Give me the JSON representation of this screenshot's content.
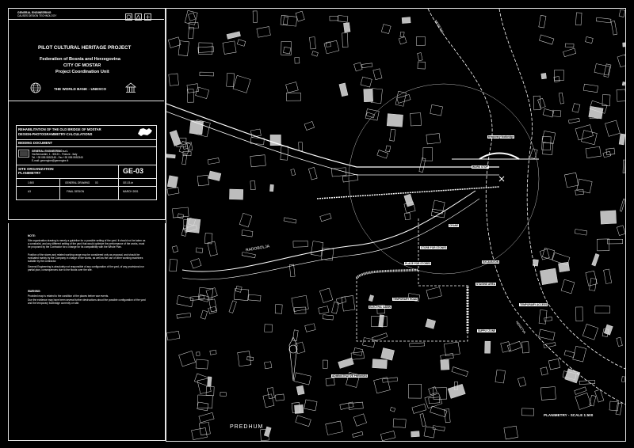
{
  "company": {
    "name": "GENERAL ENGINEERING",
    "sub": "CAUSES DESIGN TECHNOLOGY"
  },
  "project": {
    "title": "PILOT CULTURAL HERITAGE PROJECT",
    "line1": "Federation of Bosnia and Herzegovina",
    "line2": "CITY OF MOSTAR",
    "line3": "Project Coordination Unit",
    "sponsor": "THE WORLD BANK - UNESCO"
  },
  "titleblock": {
    "rehab1": "REHABILITATION OF THE OLD BRIDGE OF MOSTAR",
    "rehab2": "DESIGN-PHOTOGRAMMETRY-CALCULATIONS",
    "doc": "BIDDING DOCUMENT",
    "firm": "GENERAL ENGINEERING s.r.l.",
    "firm_addr1": "Via Bernardini, 1 - 50121 - Firenze - Italy",
    "firm_addr2": "Tel. +39 055 5552345 - Fax +39 055 5552345",
    "firm_addr3": "E-mail: genengine@genengine.it",
    "subject1": "SITE ORGANIZATION",
    "subject2": "PLANIMETRY",
    "code": "GE-03",
    "scale": "1:500",
    "category": "GENERAL DRAWING",
    "catcode": "03",
    "file": "GE-03.dr",
    "sheet": "A3",
    "status": "FINAL DESIGN",
    "date": "MARCH 2001"
  },
  "notes": {
    "heading": "NOTE:",
    "p1": "Site organization drawing is merely a guideline for a possible setting of the yard. It should not be taken as a constraint, and any different setting of the yard that would optimize the performance of the works, must be proposed by the Contractor for a change for its compatibility with the Whole Plan.",
    "p2": "Position of the stores and related working range may be considered only as proposal, and should be evaluated mainly by the Company in charge of the works, as well as the use of other working machines suitable by the contractor.",
    "p3": "General Engineering is absolutely not responsible of any configuration of the yard, of any provisional nor partial plan, consequences due to the floods over the site.",
    "heading2": "WARNING:",
    "p4": "Provided map is related to the condition of the places before war events.",
    "p5": "Due the evidence may have been several further destructions about the possible configuration of the yard and the temporary footbridge currently on site."
  },
  "map": {
    "scale_label": "PLANIMETRY - SCALE 1:500",
    "river_name_1": "NERETVA",
    "river_name_2": "NERETVA",
    "area_1": "PREDHUM",
    "area_2": "RADOBOLJA",
    "labels": [
      "temporary footbridge",
      "WORK STOP",
      "STORE FOR STONES",
      "CRANE",
      "EXCAVATION",
      "TEMPORARY ACCESS",
      "STAGING AREA",
      "TEMPORARY ROAD",
      "PLACE FOR STORES",
      "SUPPLY ZONE",
      "ADMINISTRATIVE PREMISES",
      "ELECTRIC CABIN"
    ]
  }
}
